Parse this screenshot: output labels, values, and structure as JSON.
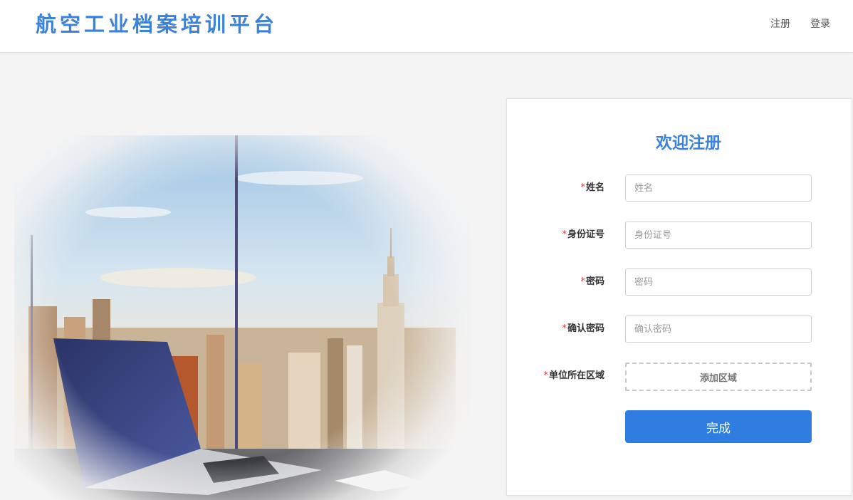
{
  "header": {
    "brand": "航空工业档案培训平台",
    "nav": {
      "register": "注册",
      "login": "登录"
    }
  },
  "form": {
    "title": "欢迎注册",
    "required_mark": "*",
    "fields": [
      {
        "label": "姓名",
        "placeholder": "姓名"
      },
      {
        "label": "身份证号",
        "placeholder": "身份证号"
      },
      {
        "label": "密码",
        "placeholder": "密码"
      },
      {
        "label": "确认密码",
        "placeholder": "确认密码"
      }
    ],
    "region": {
      "label": "单位所在区域",
      "button": "添加区域"
    },
    "submit": "完成"
  },
  "colors": {
    "brand": "#3b82d8",
    "primary_button": "#2f7de1",
    "required": "#e53935"
  },
  "icons": {
    "hero": "city-skyline-laptop-illustration"
  }
}
